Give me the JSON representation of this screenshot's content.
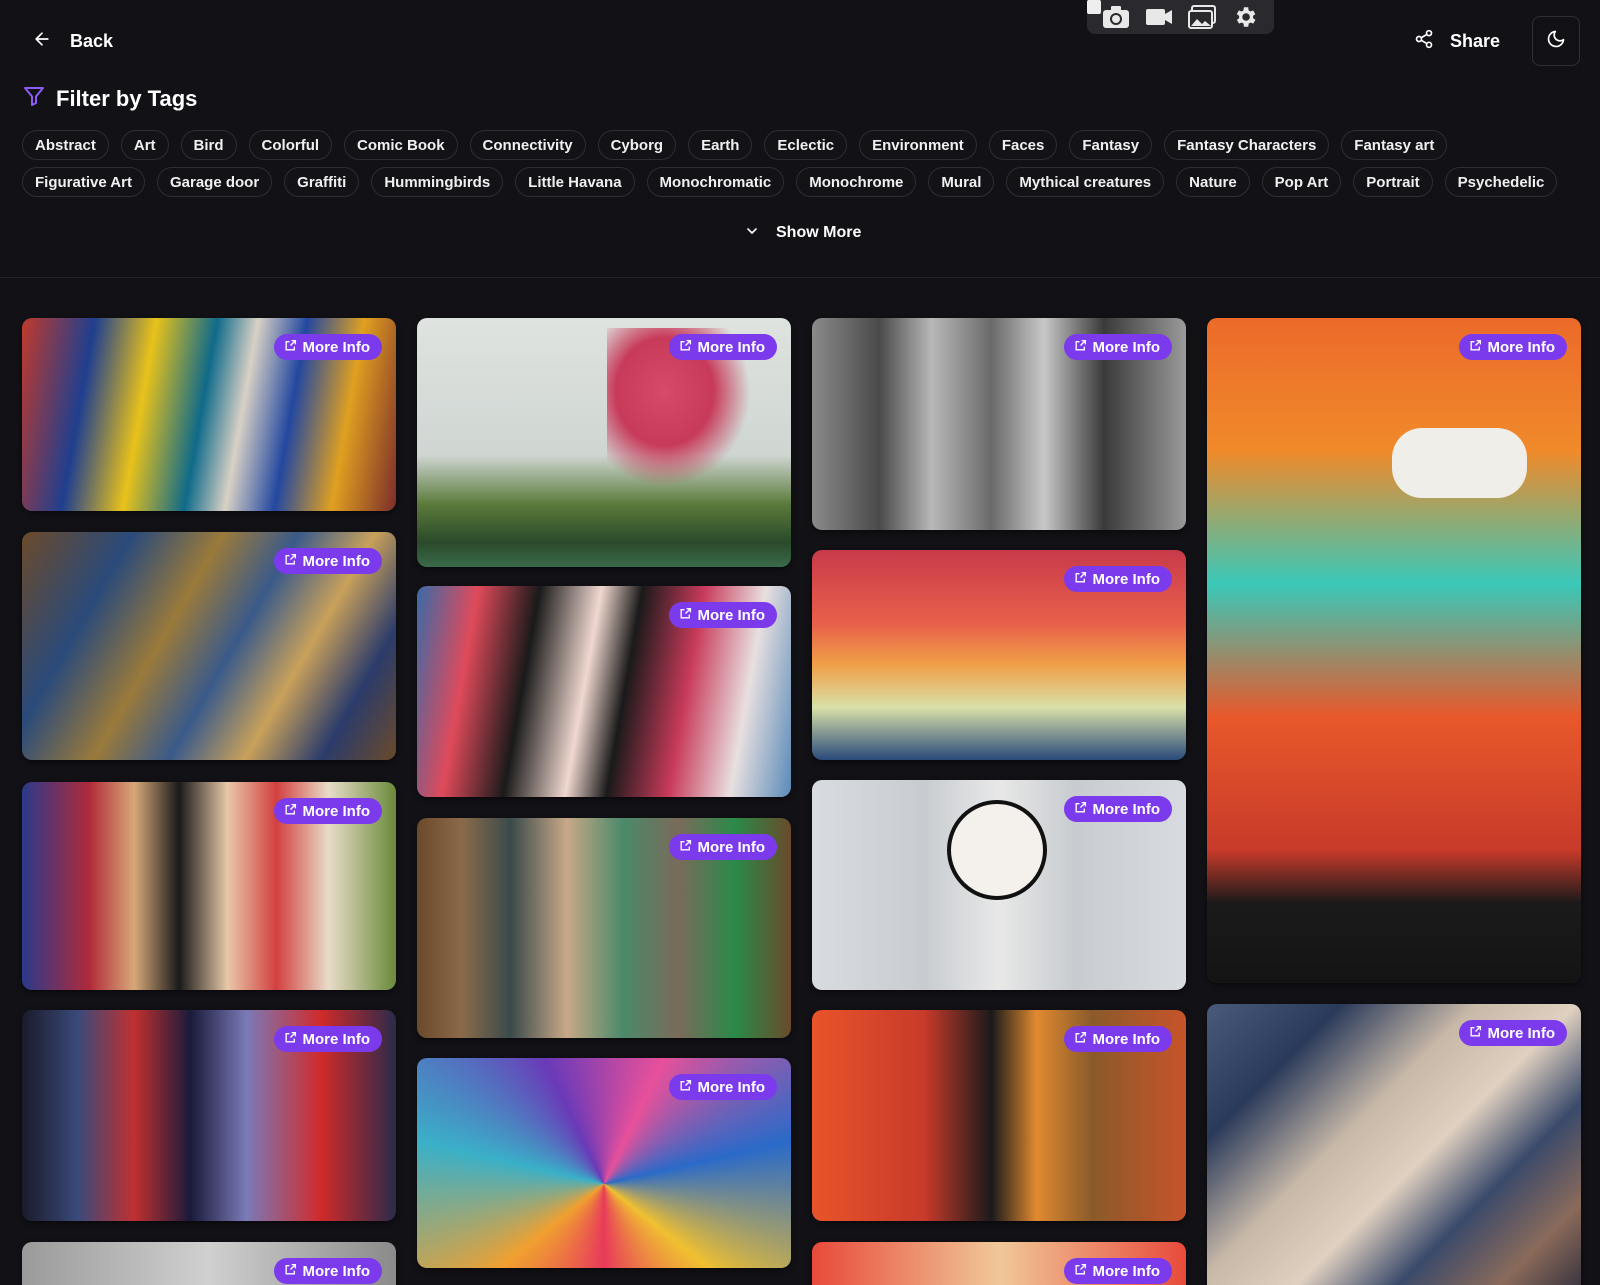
{
  "nav": {
    "back_label": "Back",
    "share_label": "Share"
  },
  "toolbar": {
    "tools": [
      "camera-icon",
      "video-icon",
      "gallery-icon",
      "gear-icon"
    ]
  },
  "filter": {
    "title": "Filter by Tags",
    "tags_row1": [
      "Abstract",
      "Art",
      "Bird",
      "Colorful",
      "Comic Book",
      "Connectivity",
      "Cyborg",
      "Earth",
      "Eclectic",
      "Environment",
      "Faces",
      "Fantasy",
      "Fantasy Characters",
      "Fantasy art"
    ],
    "tags_row2": [
      "Figurative Art",
      "Garage door",
      "Graffiti",
      "Hummingbirds",
      "Little Havana",
      "Monochromatic",
      "Monochrome",
      "Mural",
      "Mythical creatures",
      "Nature",
      "Pop Art",
      "Portrait",
      "Psychedelic"
    ],
    "show_more": "Show More"
  },
  "gallery": {
    "more_info_label": "More Info",
    "colors": {
      "accent": "#7c3aed",
      "background": "#121116"
    }
  }
}
